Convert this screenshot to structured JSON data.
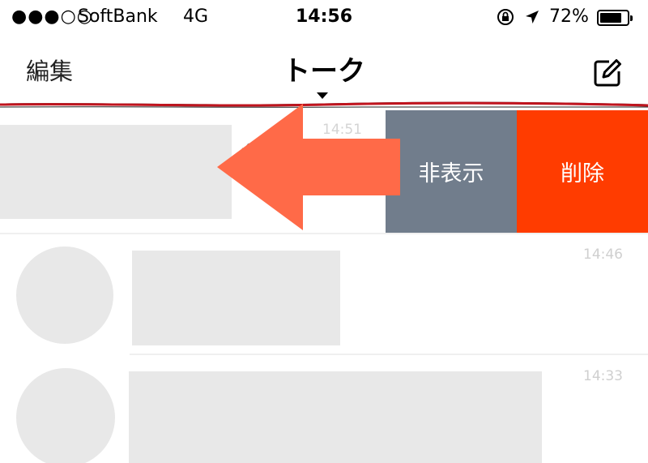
{
  "status_bar": {
    "signal": "●●●○○",
    "carrier": "SoftBank",
    "network": "4G",
    "time": "14:56",
    "lock_icon": "orientation-lock-icon",
    "location_icon": "location-arrow-icon",
    "battery_percent": "72%",
    "battery_level": 0.72
  },
  "nav": {
    "edit_label": "編集",
    "title": "トーク",
    "compose_icon": "compose-icon"
  },
  "swiped_row": {
    "time": "14:51",
    "hide_label": "非表示",
    "delete_label": "削除",
    "hide_color": "#717d8c",
    "delete_color": "#ff3c00"
  },
  "annotation": {
    "arrow_color": "#ff6a48",
    "underline_color": "#c0141e"
  },
  "chats": [
    {
      "time": "14:46"
    },
    {
      "time": "14:33"
    }
  ]
}
